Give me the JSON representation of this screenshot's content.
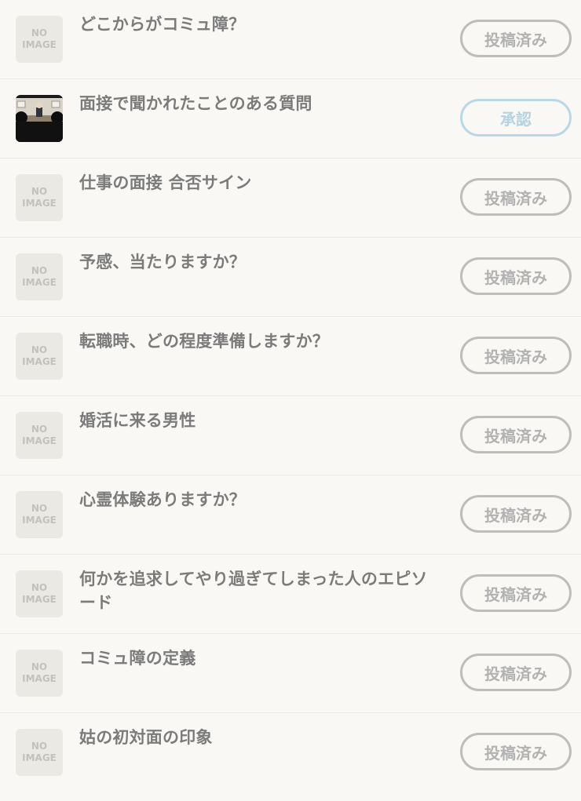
{
  "thumbnail_placeholder": {
    "line1": "NO",
    "line2": "IMAGE"
  },
  "items": [
    {
      "title": "どこからがコミュ障？",
      "status": "投稿済み"
    },
    {
      "title": "面接で聞かれたことのある質問",
      "status": "承認"
    },
    {
      "title": "仕事の面接 合否サイン",
      "status": "投稿済み"
    },
    {
      "title": "予感、当たりますか？",
      "status": "投稿済み"
    },
    {
      "title": "転職時、どの程度準備しますか？",
      "status": "投稿済み"
    },
    {
      "title": "婚活に来る男性",
      "status": "投稿済み"
    },
    {
      "title": "心霊体験ありますか？",
      "status": "投稿済み"
    },
    {
      "title": "何かを追求してやり過ぎてしまった人のエピソード",
      "status": "投稿済み"
    },
    {
      "title": "コミュ障の定義",
      "status": "投稿済み"
    },
    {
      "title": "姑の初対面の印象",
      "status": "投稿済み"
    }
  ]
}
